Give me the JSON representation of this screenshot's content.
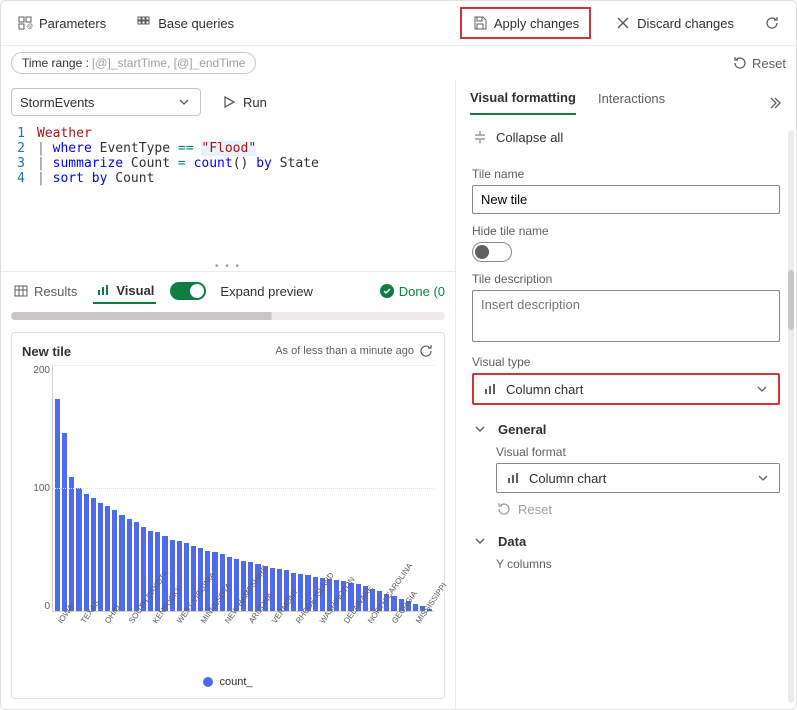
{
  "topbar": {
    "parameters": "Parameters",
    "base_queries": "Base queries",
    "apply_changes": "Apply changes",
    "discard_changes": "Discard changes"
  },
  "row2": {
    "timerange_label": "Time range :",
    "timerange_value": "[@]_startTime, [@]_endTime",
    "reset": "Reset"
  },
  "query": {
    "datasource": "StormEvents",
    "run": "Run",
    "lines": [
      {
        "n": "1",
        "tokens": [
          [
            "ident",
            "Weather"
          ]
        ]
      },
      {
        "n": "2",
        "tokens": [
          [
            "pipe",
            "| "
          ],
          [
            "blue",
            "where"
          ],
          [
            "plain",
            " EventType "
          ],
          [
            "teal",
            "=="
          ],
          [
            "plain",
            " "
          ],
          [
            "str",
            "\"Flood\""
          ]
        ]
      },
      {
        "n": "3",
        "tokens": [
          [
            "pipe",
            "| "
          ],
          [
            "blue",
            "summarize"
          ],
          [
            "plain",
            " Count "
          ],
          [
            "teal",
            "="
          ],
          [
            "plain",
            " "
          ],
          [
            "func",
            "count"
          ],
          [
            "plain",
            "() "
          ],
          [
            "blue",
            "by"
          ],
          [
            "plain",
            " State"
          ]
        ]
      },
      {
        "n": "4",
        "tokens": [
          [
            "pipe",
            "| "
          ],
          [
            "blue",
            "sort by"
          ],
          [
            "plain",
            " Count"
          ]
        ]
      }
    ]
  },
  "results": {
    "tab_results": "Results",
    "tab_visual": "Visual",
    "expand_preview": "Expand preview",
    "done": "Done (0"
  },
  "tile": {
    "title": "New tile",
    "asof": "As of less than a minute ago",
    "legend": "count_"
  },
  "chart_data": {
    "type": "bar",
    "title": "New tile",
    "xlabel": "",
    "ylabel": "",
    "ylim": [
      0,
      200
    ],
    "yticks": [
      0,
      100,
      200
    ],
    "legend": [
      "count_"
    ],
    "categories": [
      "IOWA",
      "TEXAS",
      "OHIO",
      "SOUTH DAKOTA",
      "KENTUCKY",
      "WEST VIRGINIA",
      "MINNESOTA",
      "NEW HAMPSHIRE",
      "ARIZONA",
      "VERMONT",
      "RHODE ISLAND",
      "WASHINGTON",
      "DELAWARE",
      "NORTH CAROLINA",
      "GEORGIA",
      "MISSISSIPPI"
    ],
    "values_labeled": {
      "IOWA": 172,
      "TEXAS": 145,
      "OHIO": 109,
      "SOUTH DAKOTA": 95,
      "KENTUCKY": 82,
      "WEST VIRGINIA": 72,
      "MINNESOTA": 64,
      "NEW HAMPSHIRE": 57,
      "ARIZONA": 51,
      "VERMONT": 46,
      "RHODE ISLAND": 41,
      "WASHINGTON": 37,
      "DELAWARE": 33,
      "NORTH CAROLINA": 29,
      "GEORGIA": 26,
      "MISSISSIPPI": 23
    },
    "all_values": [
      172,
      145,
      109,
      100,
      95,
      92,
      88,
      85,
      82,
      78,
      75,
      72,
      68,
      65,
      64,
      61,
      58,
      57,
      55,
      53,
      51,
      49,
      48,
      46,
      44,
      42,
      41,
      40,
      38,
      37,
      35,
      34,
      33,
      31,
      30,
      29,
      28,
      27,
      26,
      25,
      24,
      23,
      22,
      20,
      18,
      16,
      14,
      12,
      10,
      8,
      6,
      4,
      2
    ]
  },
  "panel": {
    "tab_visual_formatting": "Visual formatting",
    "tab_interactions": "Interactions",
    "collapse_all": "Collapse all",
    "tile_name_label": "Tile name",
    "tile_name_value": "New tile",
    "hide_tile_name_label": "Hide tile name",
    "tile_desc_label": "Tile description",
    "tile_desc_placeholder": "Insert description",
    "visual_type_label": "Visual type",
    "visual_type_value": "Column chart",
    "general_label": "General",
    "visual_format_label": "Visual format",
    "visual_format_value": "Column chart",
    "reset": "Reset",
    "data_label": "Data",
    "y_columns_label": "Y columns"
  }
}
